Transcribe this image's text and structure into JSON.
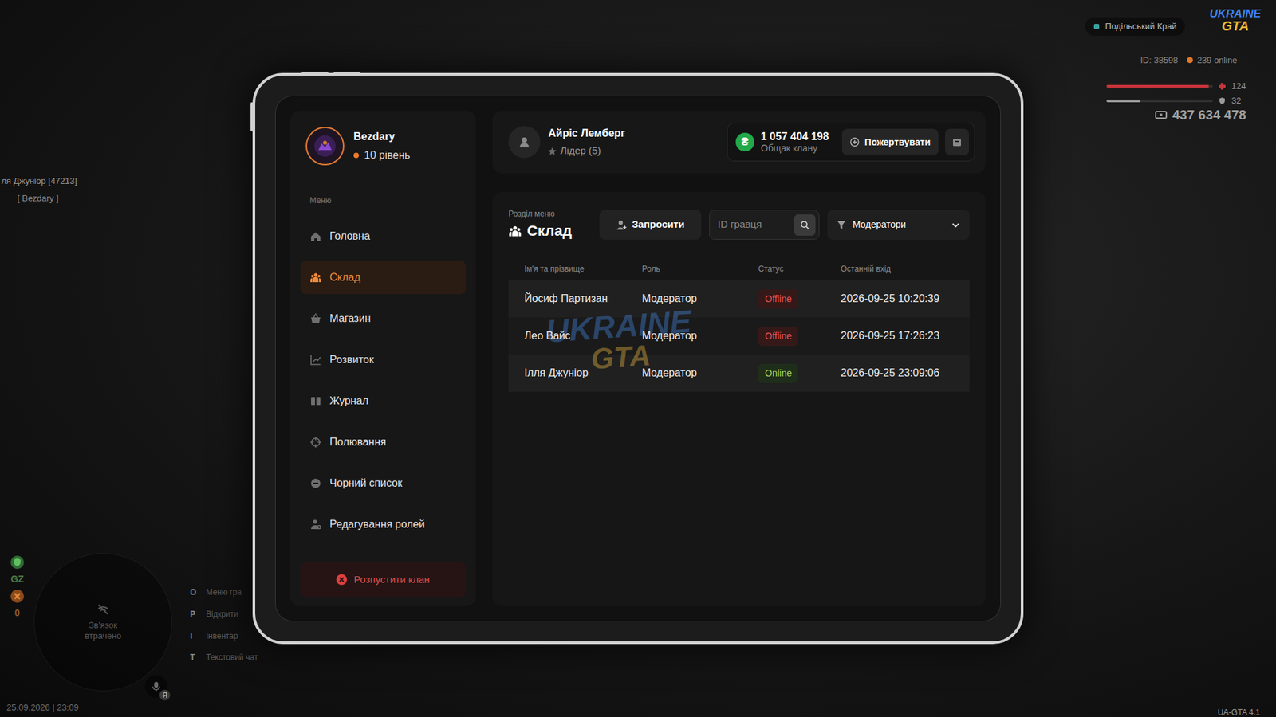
{
  "hud": {
    "region": "Подільський Край",
    "logo": {
      "top": "UKRAINE",
      "bottom": "GTA"
    },
    "player_id": "ID: 38598",
    "online": "239 online",
    "health": {
      "value": "124",
      "level": 0.96
    },
    "armor": {
      "value": "32",
      "level": 0.32
    },
    "money": "437 634 478",
    "nameplate": {
      "name": "ля Джуніор [47213]",
      "tag": "[ Bezdary ]"
    },
    "indicators": [
      "GZ",
      "0"
    ],
    "minimap_text": "Зв'язок втрачено",
    "hotkeys": [
      {
        "key": "O",
        "label": "Меню гра"
      },
      {
        "key": "P",
        "label": "Відкрити"
      },
      {
        "key": "I",
        "label": "Інвентар"
      },
      {
        "key": "T",
        "label": "Текстовий чат"
      }
    ],
    "mic_badge": "Я",
    "datetime": "25.09.2026 | 23:09",
    "version": "UA-GTA 4.1"
  },
  "tablet": {
    "profile": {
      "name": "Bezdary",
      "level": "10 рівень",
      "color": "#f07a2a"
    },
    "menu_label": "Меню",
    "menu": [
      {
        "label": "Головна",
        "selected": false
      },
      {
        "label": "Склад",
        "selected": true
      },
      {
        "label": "Магазин",
        "selected": false
      },
      {
        "label": "Розвиток",
        "selected": false
      },
      {
        "label": "Журнал",
        "selected": false
      },
      {
        "label": "Полювання",
        "selected": false
      },
      {
        "label": "Чорний список",
        "selected": false
      },
      {
        "label": "Редагування ролей",
        "selected": false
      }
    ],
    "disband_button": "Розпустити клан",
    "leader": {
      "name": "Айріс Лемберг",
      "role": "Лідер (5)"
    },
    "balance": {
      "currency": "₴",
      "amount": "1 057 404 198",
      "label": "Общак клану"
    },
    "donate_button": "Пожертвувати",
    "section": {
      "label": "Розділ меню",
      "title": "Склад"
    },
    "invite_button": "Запросити",
    "search": {
      "placeholder": "ID гравця"
    },
    "filter": {
      "value": "Модератори"
    },
    "watermark": {
      "top": "UKRAINE",
      "bottom": "GTA"
    },
    "table": {
      "columns": [
        "Ім'я та прізвище",
        "Роль",
        "Статус",
        "Останній вхід"
      ],
      "rows": [
        {
          "name": "Йосиф Партизан",
          "role": "Модератор",
          "status": "Offline",
          "online": false,
          "last": "2026-09-25 10:20:39"
        },
        {
          "name": "Лео Вайс",
          "role": "Модератор",
          "status": "Offline",
          "online": false,
          "last": "2026-09-25 17:26:23"
        },
        {
          "name": "Ілля Джуніор",
          "role": "Модератор",
          "status": "Online",
          "online": true,
          "last": "2026-09-25 23:09:06"
        }
      ]
    }
  }
}
